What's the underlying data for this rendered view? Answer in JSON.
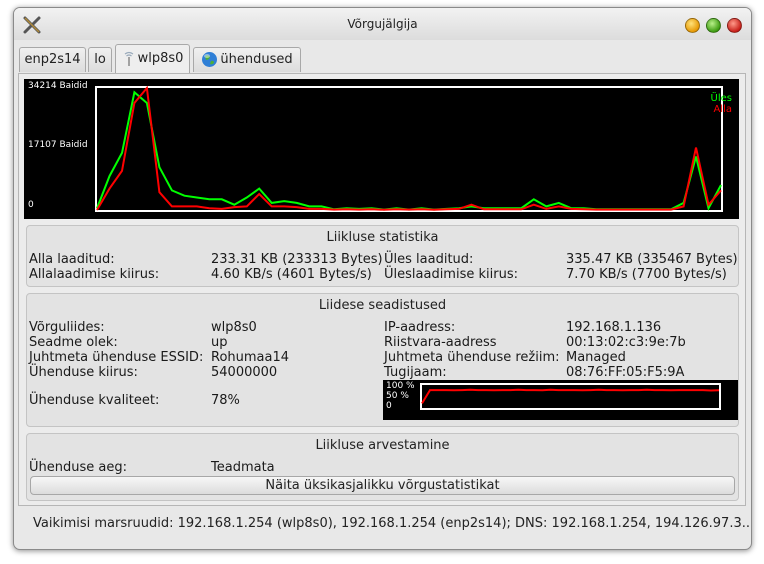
{
  "window": {
    "title": "Võrgujälgija"
  },
  "tabs": [
    {
      "label": "enp2s14",
      "icon": null
    },
    {
      "label": "lo",
      "icon": null
    },
    {
      "label": "wlp8s0",
      "icon": "wireless-icon",
      "active": true
    },
    {
      "label": "ühendused",
      "icon": "globe-icon"
    }
  ],
  "traffic_graph": {
    "y_max_label": "34214 Baidid",
    "y_mid_label": "17107 Baidid",
    "y_min_label": "0",
    "legend_up": "Üles",
    "legend_down": "Alla",
    "colors": {
      "up": "#00ff00",
      "down": "#ff0000",
      "background": "#000000",
      "frame": "#ffffff"
    }
  },
  "chart_data": [
    {
      "type": "line",
      "ylim": [
        0,
        34214
      ],
      "series": [
        {
          "name": "Üles",
          "values": [
            500,
            9500,
            16000,
            33000,
            30000,
            12000,
            5500,
            4000,
            3500,
            3000,
            3000,
            1500,
            3500,
            6000,
            2000,
            2500,
            2000,
            1000,
            1000,
            200,
            500,
            300,
            500,
            100,
            500,
            100,
            500,
            100,
            300,
            500,
            1000,
            500,
            500,
            500,
            500,
            3000,
            1000,
            2000,
            500,
            500,
            200,
            200,
            200,
            200,
            200,
            200,
            200,
            2000,
            15000,
            500,
            7000
          ]
        },
        {
          "name": "Alla",
          "values": [
            0,
            6000,
            11000,
            30000,
            34214,
            5000,
            1000,
            1000,
            1000,
            500,
            300,
            800,
            1000,
            4500,
            1000,
            1000,
            800,
            300,
            300,
            100,
            200,
            100,
            200,
            50,
            200,
            100,
            200,
            50,
            200,
            300,
            1500,
            200,
            200,
            200,
            200,
            1500,
            300,
            1000,
            300,
            200,
            100,
            100,
            100,
            100,
            100,
            100,
            100,
            1000,
            17500,
            1500,
            5500
          ]
        }
      ]
    },
    {
      "type": "line",
      "ylim": [
        0,
        100
      ],
      "values": [
        20,
        78,
        78,
        78,
        77,
        78,
        79,
        78,
        78,
        77,
        78,
        78,
        79,
        78,
        78,
        77,
        79,
        78,
        78,
        78,
        77,
        78,
        79,
        78,
        78,
        77,
        78,
        78,
        79,
        78,
        78,
        77,
        78,
        78,
        78,
        78,
        76,
        77
      ]
    }
  ],
  "traffic_stats": {
    "title": "Liikluse statistika",
    "rx_label": "Alla laaditud:",
    "rx_value": "233.31 KB (233313 Bytes)",
    "tx_label": "Üles laaditud:",
    "tx_value": "335.47 KB (335467 Bytes)",
    "rx_speed_label": "Allalaadimise kiirus:",
    "rx_speed_value": "4.60 KB/s (4601 Bytes/s)",
    "tx_speed_label": "Üleslaadimise kiirus:",
    "tx_speed_value": "7.70 KB/s (7700 Bytes/s)"
  },
  "interface": {
    "title": "Liidese seadistused",
    "if_label": "Võrguliides:",
    "if_value": "wlp8s0",
    "state_label": "Seadme olek:",
    "state_value": "up",
    "essid_label": "Juhtmeta ühenduse ESSID:",
    "essid_value": "Rohumaa14",
    "speed_label": "Ühenduse kiirus:",
    "speed_value": "54000000",
    "quality_label": "Ühenduse kvaliteet:",
    "quality_value": "78%",
    "ip_label": "IP-aadress:",
    "ip_value": "192.168.1.136",
    "hw_label": "Riistvara-aadress",
    "hw_value": "00:13:02:c3:9e:7b",
    "mode_label": "Juhtmeta ühenduse režiim:",
    "mode_value": "Managed",
    "ap_label": "Tugijaam:",
    "ap_value": "08:76:FF:05:F5:9A",
    "quality_graph": {
      "label_100": "100 %",
      "label_50": "50 %",
      "label_0": "0",
      "line_color": "#ff0000"
    }
  },
  "accounting": {
    "title": "Liikluse arvestamine",
    "uptime_label": "Ühenduse aeg:",
    "uptime_value": "Teadmata",
    "detail_button": "Näita üksikasjalikku võrgustatistikat"
  },
  "statusbar": {
    "text": "Vaikimisi marsruudid: 192.168.1.254 (wlp8s0), 192.168.1.254 (enp2s14); DNS: 192.168.1.254, 194.126.97.3..."
  }
}
